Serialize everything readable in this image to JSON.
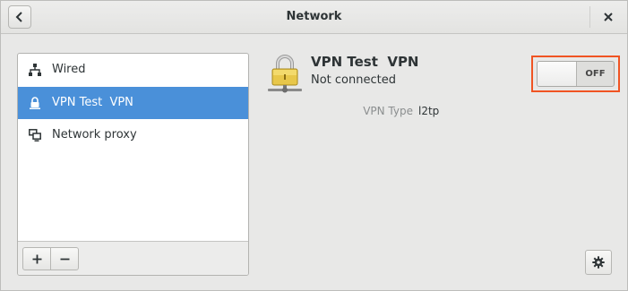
{
  "window": {
    "title": "Network",
    "back_icon": "chevron-left-icon",
    "close_icon": "close-icon"
  },
  "sidebar": {
    "items": [
      {
        "label": "Wired",
        "icon": "wired-network-icon",
        "selected": false
      },
      {
        "label": "VPN Test  VPN",
        "icon": "vpn-lock-icon",
        "selected": true
      },
      {
        "label": "Network proxy",
        "icon": "network-proxy-icon",
        "selected": false
      }
    ],
    "add_label": "+",
    "remove_label": "−"
  },
  "detail": {
    "name": "VPN Test  VPN",
    "status": "Not connected",
    "type_label": "VPN Type",
    "type_value": "l2tp",
    "toggle": {
      "state_label": "OFF",
      "on": false
    },
    "highlight_color": "#f05423",
    "settings_icon": "gear-icon"
  },
  "colors": {
    "selection": "#4a90d9",
    "window_bg": "#e8e8e7"
  }
}
